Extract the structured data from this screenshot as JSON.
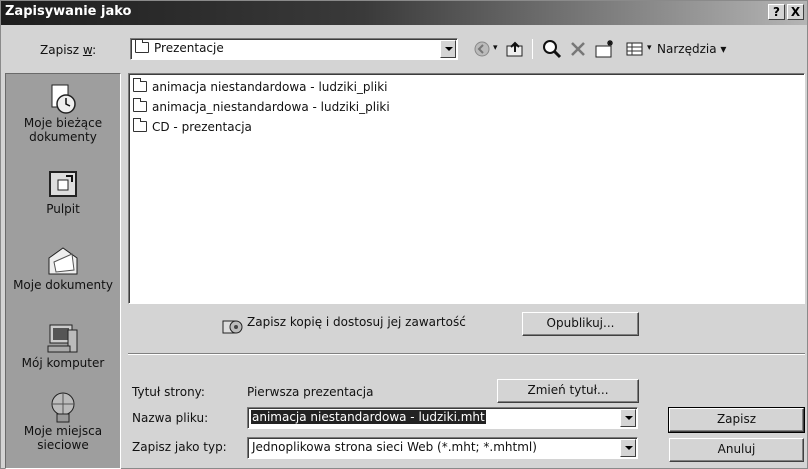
{
  "window": {
    "title": "Zapisywanie jako",
    "help_label": "?",
    "close_label": "X"
  },
  "location": {
    "label_prefix": "Zapisz ",
    "label_accel": "w",
    "label_suffix": ":",
    "value": "Prezentacje"
  },
  "toolbar": {
    "tools_label": "Narzędzia",
    "icons": [
      "back-icon",
      "up-folder-icon",
      "search-web-icon",
      "delete-icon",
      "new-folder-icon",
      "views-icon"
    ]
  },
  "places": [
    {
      "label": "Moje bieżące dokumenty",
      "icon": "recent-documents-icon"
    },
    {
      "label": "Pulpit",
      "icon": "desktop-icon"
    },
    {
      "label": "Moje dokumenty",
      "icon": "my-documents-icon"
    },
    {
      "label": "Mój komputer",
      "icon": "my-computer-icon"
    },
    {
      "label": "Moje miejsca sieciowe",
      "icon": "network-places-icon"
    }
  ],
  "files": [
    {
      "name": "animacja niestandardowa - ludziki_pliki"
    },
    {
      "name": "animacja_niestandardowa - ludziki_pliki"
    },
    {
      "name": "CD - prezentacja"
    }
  ],
  "publish": {
    "copy_label": "Zapisz kopię i dostosuj jej zawartość",
    "publish_button": "Opublikuj..."
  },
  "page_title": {
    "label": "Tytuł strony:",
    "value": "Pierwsza prezentacja",
    "change_button": "Zmień tytuł..."
  },
  "filename": {
    "label": "Nazwa pliku:",
    "value": "animacja niestandardowa - ludziki.mht"
  },
  "filetype": {
    "label": "Zapisz jako typ:",
    "value": "Jednoplikowa strona sieci Web (*.mht; *.mhtml)"
  },
  "actions": {
    "save": "Zapisz",
    "cancel": "Anuluj"
  }
}
